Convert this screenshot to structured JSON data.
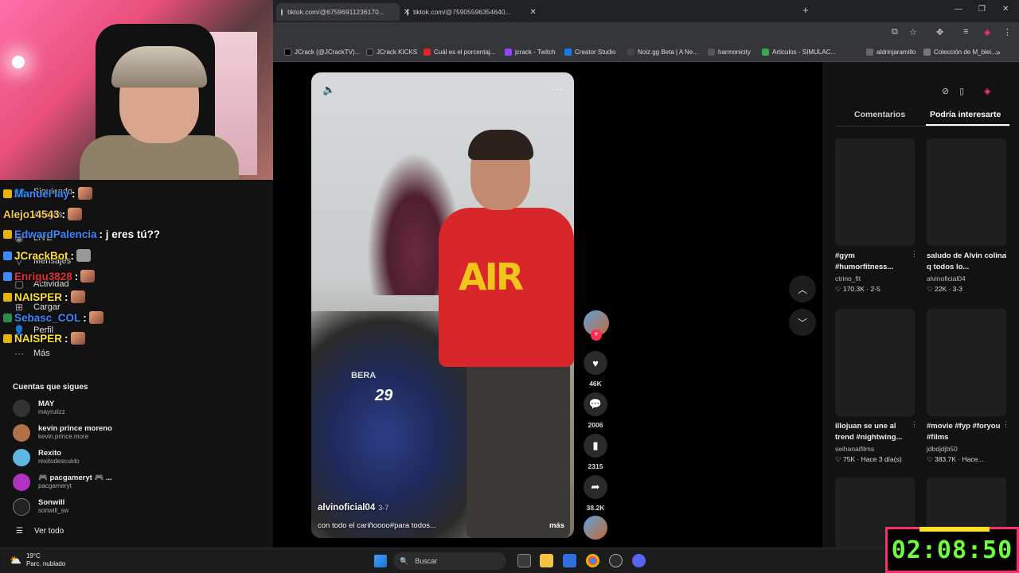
{
  "browser": {
    "tabs": [
      {
        "label": "tiktok.com/@67596911236170..."
      },
      {
        "label": "tiktok.com/@75905596354640..."
      }
    ],
    "bookmarks": [
      {
        "label": "JCrack (@JCrackTV)...",
        "color": "#000000"
      },
      {
        "label": "JCrack KICKS",
        "color": "#222222"
      },
      {
        "label": "Cuál es el porcentaj...",
        "color": "#e02424"
      },
      {
        "label": "jcrack - Twitch",
        "color": "#9146ff"
      },
      {
        "label": "Creator Studio",
        "color": "#1877f2"
      },
      {
        "label": "Noiz.gg Beta | A Ne...",
        "color": "#444444"
      },
      {
        "label": "harmonicity",
        "color": "#555555"
      },
      {
        "label": "Articulos - SIMULAC...",
        "color": "#34a853"
      },
      {
        "label": "aldrinjaramillo",
        "color": "#666666"
      },
      {
        "label": "Colección de M_blei...",
        "color": "#777777"
      }
    ]
  },
  "chat": [
    {
      "user": "Manuel lay",
      "color": "#3b8bff",
      "message": ":"
    },
    {
      "user": "Alejo14543",
      "color": "#f7c948",
      "message": ":"
    },
    {
      "user": "EdwardPalencia",
      "color": "#3b8bff",
      "message": ": j eres tú??"
    },
    {
      "user": "JCrackBot",
      "color": "#ffe227",
      "message": ":"
    },
    {
      "user": "Enrigu3828",
      "color": "#e03030",
      "message": ":"
    },
    {
      "user": "NAISPER",
      "color": "#ffe227",
      "message": ":"
    },
    {
      "user": "Sebasc_COL",
      "color": "#3b8bff",
      "message": ":"
    },
    {
      "user": "NAISPER",
      "color": "#ffe227",
      "message": ":"
    }
  ],
  "sidebar": {
    "nav": [
      {
        "label": "Siguiendo",
        "icon": "following-icon"
      },
      {
        "label": "Amigos",
        "icon": "friends-icon"
      },
      {
        "label": "LIVE",
        "icon": "live-icon"
      },
      {
        "label": "Mensajes",
        "icon": "messages-icon"
      },
      {
        "label": "Actividad",
        "icon": "activity-icon"
      },
      {
        "label": "Cargar",
        "icon": "upload-icon"
      },
      {
        "label": "Perfil",
        "icon": "profile-icon"
      },
      {
        "label": "Más",
        "icon": "more-icon"
      }
    ],
    "following_title": "Cuentas que sigues",
    "accounts": [
      {
        "name": "MAY",
        "username": "mayruiizz",
        "color": "#333333"
      },
      {
        "name": "kevin prince moreno",
        "username": "kevin.prince.more",
        "color": "#b07048"
      },
      {
        "name": "Rexito",
        "username": "rexitodescuido",
        "color": "#5fb6e0"
      },
      {
        "name": "🎮 pacgameryt 🎮 ...",
        "username": "pacgameryt",
        "color": "#b030c0"
      },
      {
        "name": "Sonwill",
        "username": "sonwill_sw",
        "color": "#222222"
      }
    ],
    "see_all": "Ver todo"
  },
  "video": {
    "author": "alvinoficial04",
    "date": "3-7",
    "caption": "con todo el cariñoooo#para todos...",
    "more": "más",
    "moto_brand": "BERA",
    "moto_number": "29",
    "shirt_text": "AIR",
    "likes": "46K",
    "comments": "2006",
    "saves": "2315",
    "shares": "38.2K"
  },
  "right_panel": {
    "tabs": [
      "Comentarios",
      "Podría interesarte"
    ],
    "active_tab": 1,
    "cards": [
      {
        "title": "#gym #humorfitness...",
        "author": "ctrino_fit",
        "stats": "♡ 170.3K · 2-5"
      },
      {
        "title": "saludo de Alvin colina q todos lo...",
        "author": "alvinoficial04",
        "stats": "♡ 22K · 3-3"
      },
      {
        "title": "illojuan se une al trend #nightwing...",
        "author": "seihanaifilms",
        "stats": "♡ 75K · Hace 3 día(s)"
      },
      {
        "title": "#movie #fyp #foryou #films",
        "author": "jdbdjdjb50",
        "stats": "♡ 383.7K · Hace..."
      },
      {
        "title": "",
        "author": "",
        "stats": ""
      },
      {
        "title": "",
        "author": "",
        "stats": ""
      }
    ]
  },
  "taskbar": {
    "temperature": "19°C",
    "weather": "Parc. nublado",
    "search_placeholder": "Buscar"
  },
  "timer": "02:08:50"
}
